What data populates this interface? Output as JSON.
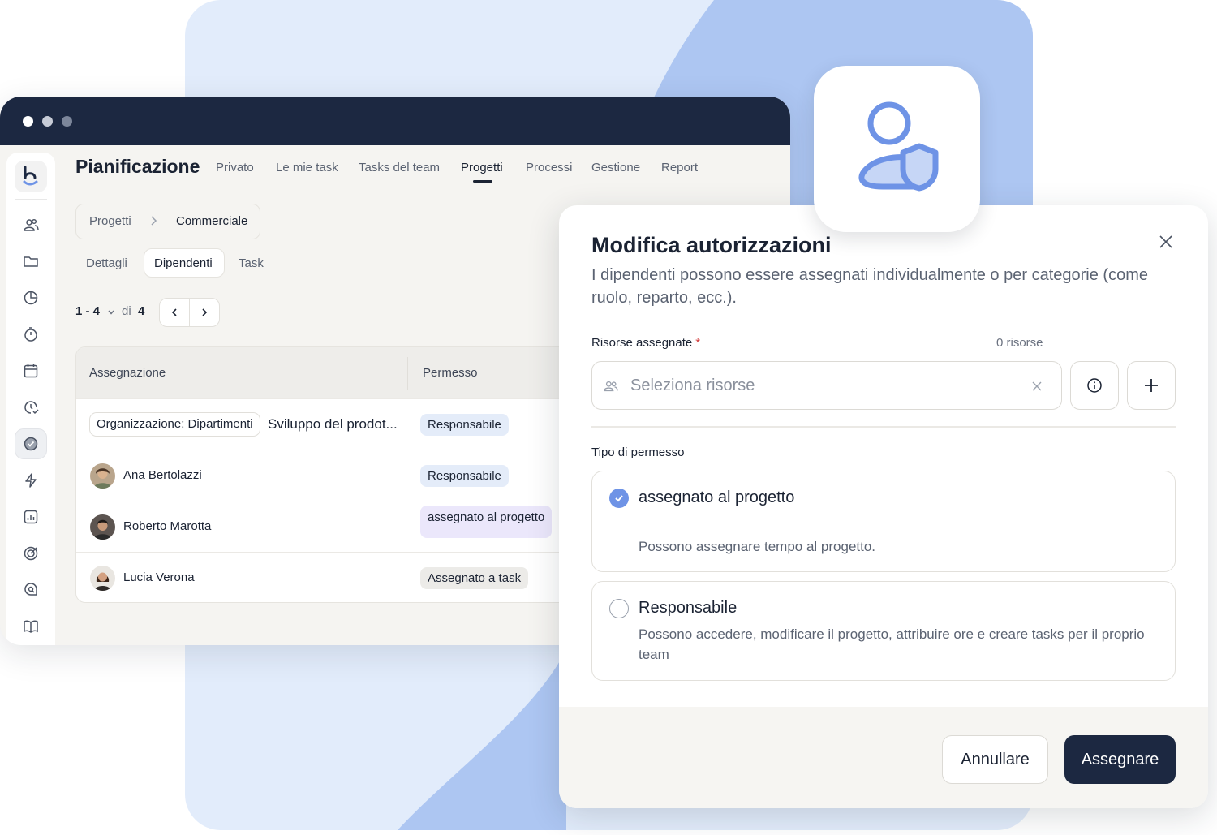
{
  "window": {
    "controls": [
      "close",
      "minimize",
      "maximize"
    ]
  },
  "sidebar": {
    "logo": "app-logo",
    "items": [
      {
        "icon": "people-icon"
      },
      {
        "icon": "folder-icon"
      },
      {
        "icon": "pie-chart-icon"
      },
      {
        "icon": "stopwatch-icon"
      },
      {
        "icon": "calendar-icon"
      },
      {
        "icon": "clock-check-icon"
      },
      {
        "icon": "check-circle-icon",
        "active": true
      },
      {
        "icon": "lightning-icon"
      },
      {
        "icon": "report-chart-icon"
      },
      {
        "icon": "target-icon"
      },
      {
        "icon": "chat-search-icon"
      },
      {
        "icon": "book-icon"
      }
    ]
  },
  "header": {
    "title": "Pianificazione",
    "tabs": [
      {
        "label": "Privato"
      },
      {
        "label": "Le mie task"
      },
      {
        "label": "Tasks del team"
      },
      {
        "label": "Progetti",
        "active": true
      },
      {
        "label": "Processi"
      },
      {
        "label": "Gestione"
      },
      {
        "label": "Report"
      }
    ]
  },
  "breadcrumb": {
    "root": "Progetti",
    "current": "Commerciale"
  },
  "subtabs": [
    {
      "label": "Dettagli"
    },
    {
      "label": "Dipendenti",
      "active": true
    },
    {
      "label": "Task"
    }
  ],
  "pagination": {
    "range": "1 - 4",
    "of_label": "di",
    "total": "4"
  },
  "table": {
    "columns": [
      "Assegnazione",
      "Permesso"
    ],
    "rows": [
      {
        "chip": "Organizzazione: Dipartimenti",
        "extra": "Sviluppo del prodot...",
        "permission": "Responsabile"
      },
      {
        "name": "Ana Bertolazzi",
        "permission": "Responsabile"
      },
      {
        "name": "Roberto Marotta",
        "permission": "assegnato al progetto"
      },
      {
        "name": "Lucia Verona",
        "permission": "Assegnato a task"
      }
    ]
  },
  "modal": {
    "title": "Modifica autorizzazioni",
    "description": "I dipendenti possono essere assegnati individualmente o per categorie (come ruolo, reparto, ecc.).",
    "resources": {
      "label": "Risorse assegnate",
      "required_mark": "*",
      "count": "0 risorse",
      "placeholder": "Seleziona risorse"
    },
    "permission_section": "Tipo di permesso",
    "options": [
      {
        "title": "assegnato al progetto",
        "description": "Possono assegnare tempo al progetto.",
        "checked": true
      },
      {
        "title": "Responsabile",
        "description": "Possono accedere, modificare il progetto, attribuire ore e creare tasks per il proprio team",
        "checked": false
      }
    ],
    "cancel_label": "Annullare",
    "assign_label": "Assegnare"
  },
  "colors": {
    "accent": "#6e93e6",
    "dark": "#1c2841",
    "background_panel": "#e2ecfb",
    "background_shape": "#adc6f2"
  }
}
